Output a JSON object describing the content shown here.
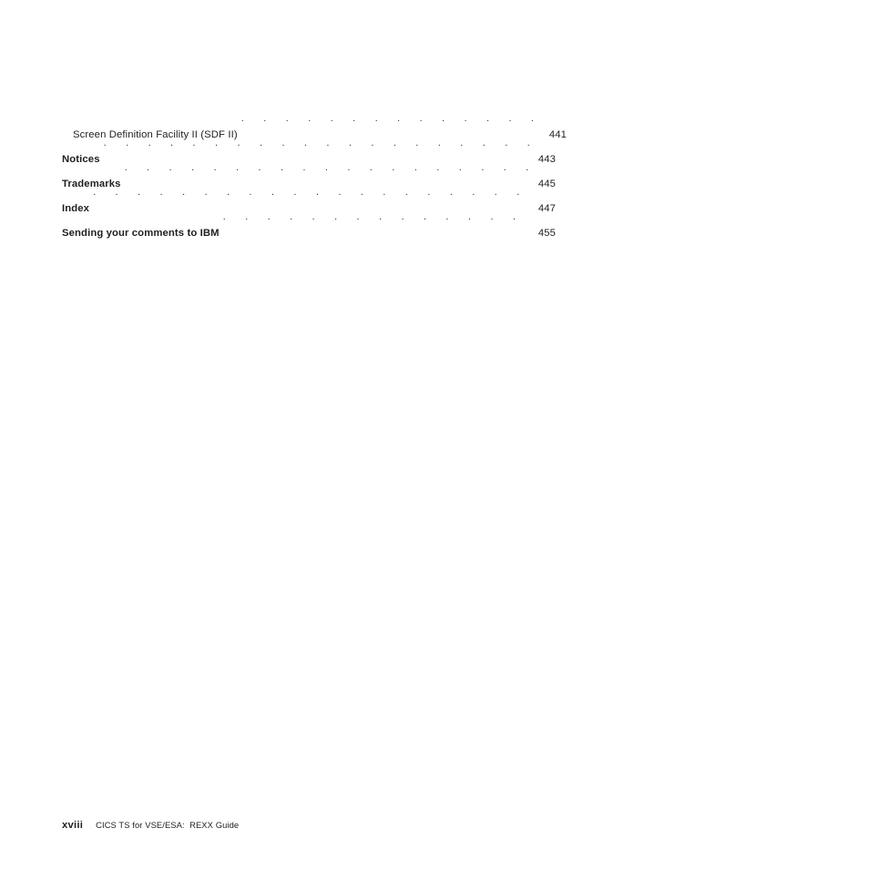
{
  "page": {
    "background_color": "#ffffff",
    "text_color": "#1f1f1f",
    "leader_color": "#3a3a3a"
  },
  "toc": {
    "entries": [
      {
        "title": "Screen Definition Facility II (SDF II)",
        "page": "441",
        "level": 2,
        "bold": false
      },
      {
        "title": "Notices",
        "page": "443",
        "level": 1,
        "bold": true
      },
      {
        "title": "Trademarks",
        "page": "445",
        "level": 1,
        "bold": true
      },
      {
        "title": "Index",
        "page": "447",
        "level": 1,
        "bold": true
      },
      {
        "title": "Sending your comments to IBM",
        "page": "455",
        "level": 1,
        "bold": true
      }
    ]
  },
  "footer": {
    "folio": "xviii",
    "title": "CICS TS for VSE/ESA:  REXX Guide"
  }
}
